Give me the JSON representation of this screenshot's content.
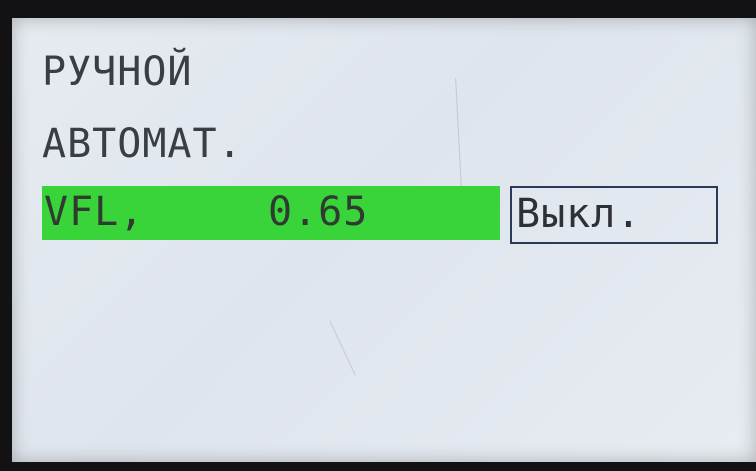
{
  "menu": {
    "items": [
      {
        "label": "РУЧНОЙ"
      },
      {
        "label": "АВТОМАТ."
      },
      {
        "label": "VFL,",
        "value": "0.65",
        "selected": true,
        "highlight_color": "#39d43a"
      }
    ]
  },
  "status": {
    "label": "Выкл."
  }
}
